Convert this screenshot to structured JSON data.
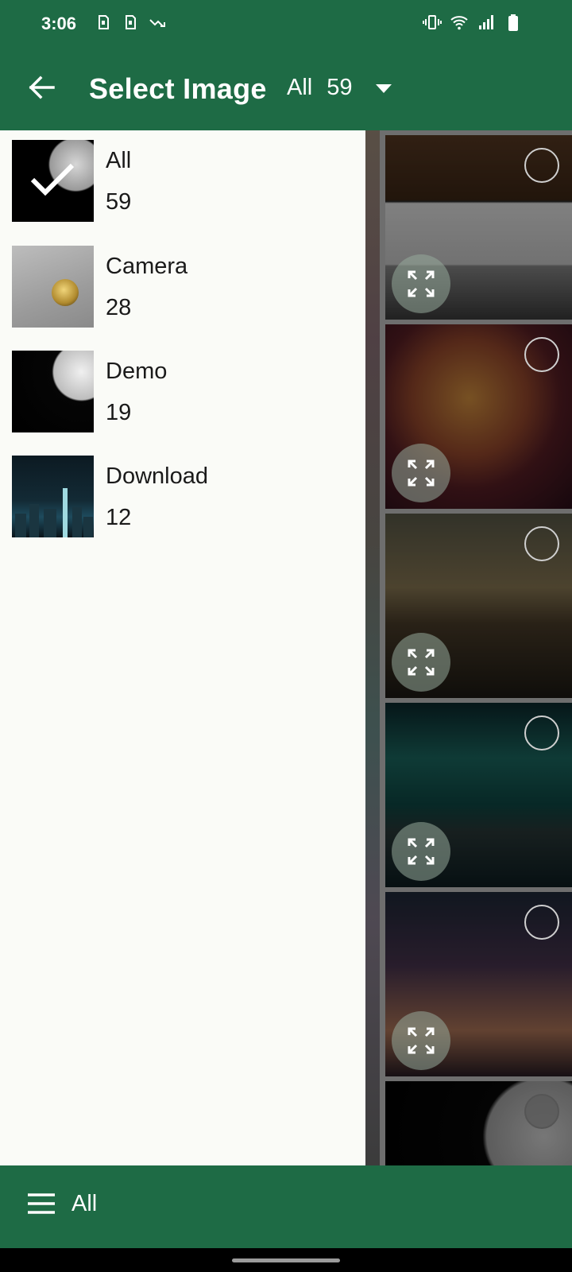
{
  "status_bar": {
    "time": "3:06",
    "left_icons": [
      "sim-icon",
      "sim-icon",
      "data-trend-icon"
    ],
    "right_icons": [
      "vibrate-icon",
      "wifi-icon",
      "signal-icon",
      "battery-icon"
    ]
  },
  "app_bar": {
    "back_icon": "arrow-left-icon",
    "title": "Select Image",
    "filter_label": "All",
    "filter_count": "59",
    "filter_icon": "caret-down-icon"
  },
  "drawer": {
    "albums": [
      {
        "name": "All",
        "count": "59",
        "selected": true
      },
      {
        "name": "Camera",
        "count": "28",
        "selected": false
      },
      {
        "name": "Demo",
        "count": "19",
        "selected": false
      },
      {
        "name": "Download",
        "count": "12",
        "selected": false
      }
    ]
  },
  "grid": {
    "tile_icons": [
      "select-circle-icon",
      "expand-icon"
    ]
  },
  "bottom_bar": {
    "menu_icon": "hamburger-menu-icon",
    "label": "All"
  },
  "colors": {
    "primary": "#1e6b45",
    "drawer_bg": "#fafbf7",
    "text": "#1a1a1a"
  }
}
